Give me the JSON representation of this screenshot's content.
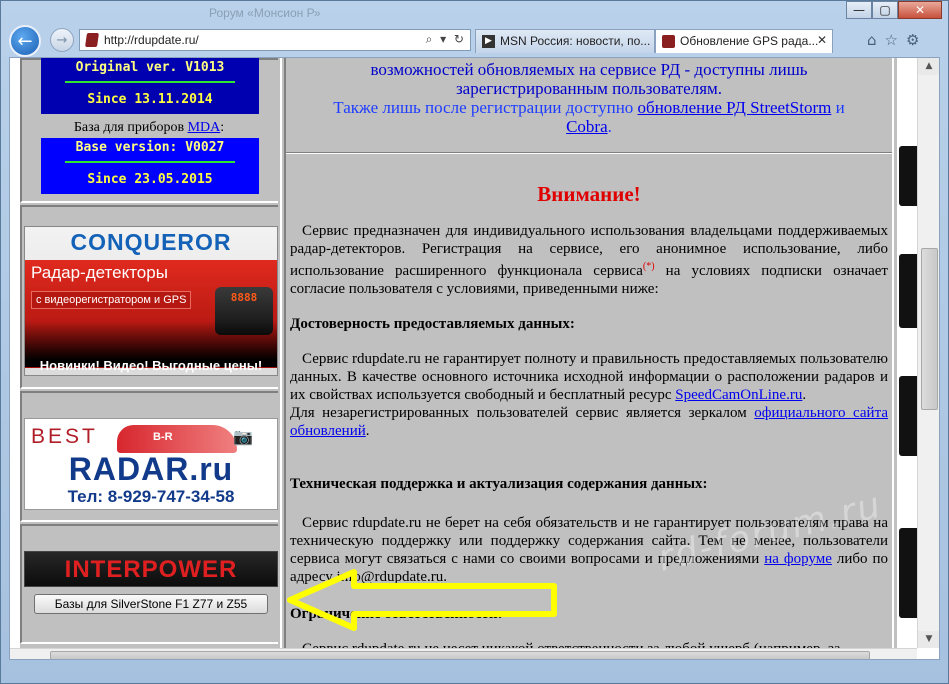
{
  "browser": {
    "faded_title": "Рорум «Монсион Р»",
    "address_url": "http://rdupdate.ru/",
    "address_tools": "⌕ ▾ ↻",
    "back_glyph": "←",
    "forward_glyph": "→",
    "tabs": [
      {
        "label": "MSN Россия: новости, по..."
      },
      {
        "label": "Обновление GPS рада...",
        "close": "✕"
      }
    ],
    "right_tools": [
      "⌂",
      "☆",
      "⚙"
    ],
    "window_buttons": {
      "minimize": "—",
      "maximize": "▢",
      "close": "✕"
    }
  },
  "sidebar": {
    "original_ver": "Original ver. V1013",
    "original_since": "Since 13.11.2014",
    "mda_prefix": "База для приборов ",
    "mda_link": "MDA",
    "mda_suffix": ":",
    "base_ver": "Base version: V0027",
    "base_since": "Since 23.05.2015",
    "banners": {
      "conqueror": {
        "title": "CONQUEROR",
        "line1": "Радар-детекторы",
        "line2": "с видеорегистратором и GPS",
        "device_display": "8888",
        "line3": "Новинки! Видео! Выгодные цены!"
      },
      "best_radar": {
        "best": "BEST",
        "badge": "B-R",
        "radar": "RADAR.ru",
        "phone": "Тел: 8-929-747-34-58"
      },
      "interpower": {
        "title": "INTERPOWER"
      }
    },
    "silverstone_button": "Базы для SilverStone F1 Z77 и Z55"
  },
  "main": {
    "notice_line1": "возможностей обновляемых на сервисе РД - доступны лишь",
    "notice_line2": "зарегистрированным пользователям.",
    "notice_line3_pre": "Также лишь после регистрации доступно ",
    "notice_line3_link": "обновление РД StreetStorm",
    "notice_line3_mid": " и",
    "notice_line4_link": "Cobra",
    "notice_line4_post": ".",
    "warning_title": "Внимание!",
    "intro_part1": "Сервис предназначен для индивидуального использования владельцами поддерживаемых радар-детекторов. Регистрация на сервисе, его анонимное использование, либо использование расширенного функционала сервиса",
    "intro_sup": "(*)",
    "intro_part2": " на условиях подписки означает согласие пользователя с условиями, приведенными ниже:",
    "section1_title": "Достоверность предоставляемых данных:",
    "section1_text": "Сервис rdupdate.ru не гарантирует полноту и правильность предоставляемых пользователю данных. В качестве основного источника исходной информации о расположении радаров и их свойствах используется свободный и бесплатный ресурс ",
    "section1_link": "SpeedCamOnLine.ru",
    "section1_end": ".",
    "section1_text2": "Для незарегистрированных пользователей сервис является зеркалом ",
    "section1_link2": "официального сайта обновлений",
    "section1_end2": ".",
    "section2_title": "Техническая поддержка и актуализация содержания данных:",
    "section2_text": "Сервис rdupdate.ru не берет на себя обязательств и не гарантирует пользователям права на техническую поддержку или поддержку содержания сайта. Тем не менее, пользователи сервиса могут связаться с нами со своими вопросами и предложениями ",
    "section2_link": "на форуме",
    "section2_text_b": " либо по адресу ",
    "section2_email": "info@rdupdate.ru",
    "section2_end": ".",
    "section3_title": "Ограничение ответственности:",
    "section3_text": "Сервис rdupdate.ru не несет никакой ответственности за любой ущерб (например, за"
  },
  "watermark": "rd-forum.ru",
  "colors": {
    "page_bg": "#c0c0c0",
    "version_box": "#0000ff",
    "warning_red": "#e00000",
    "link_blue": "#0000ee",
    "arrow_yellow": "#ffff00"
  }
}
